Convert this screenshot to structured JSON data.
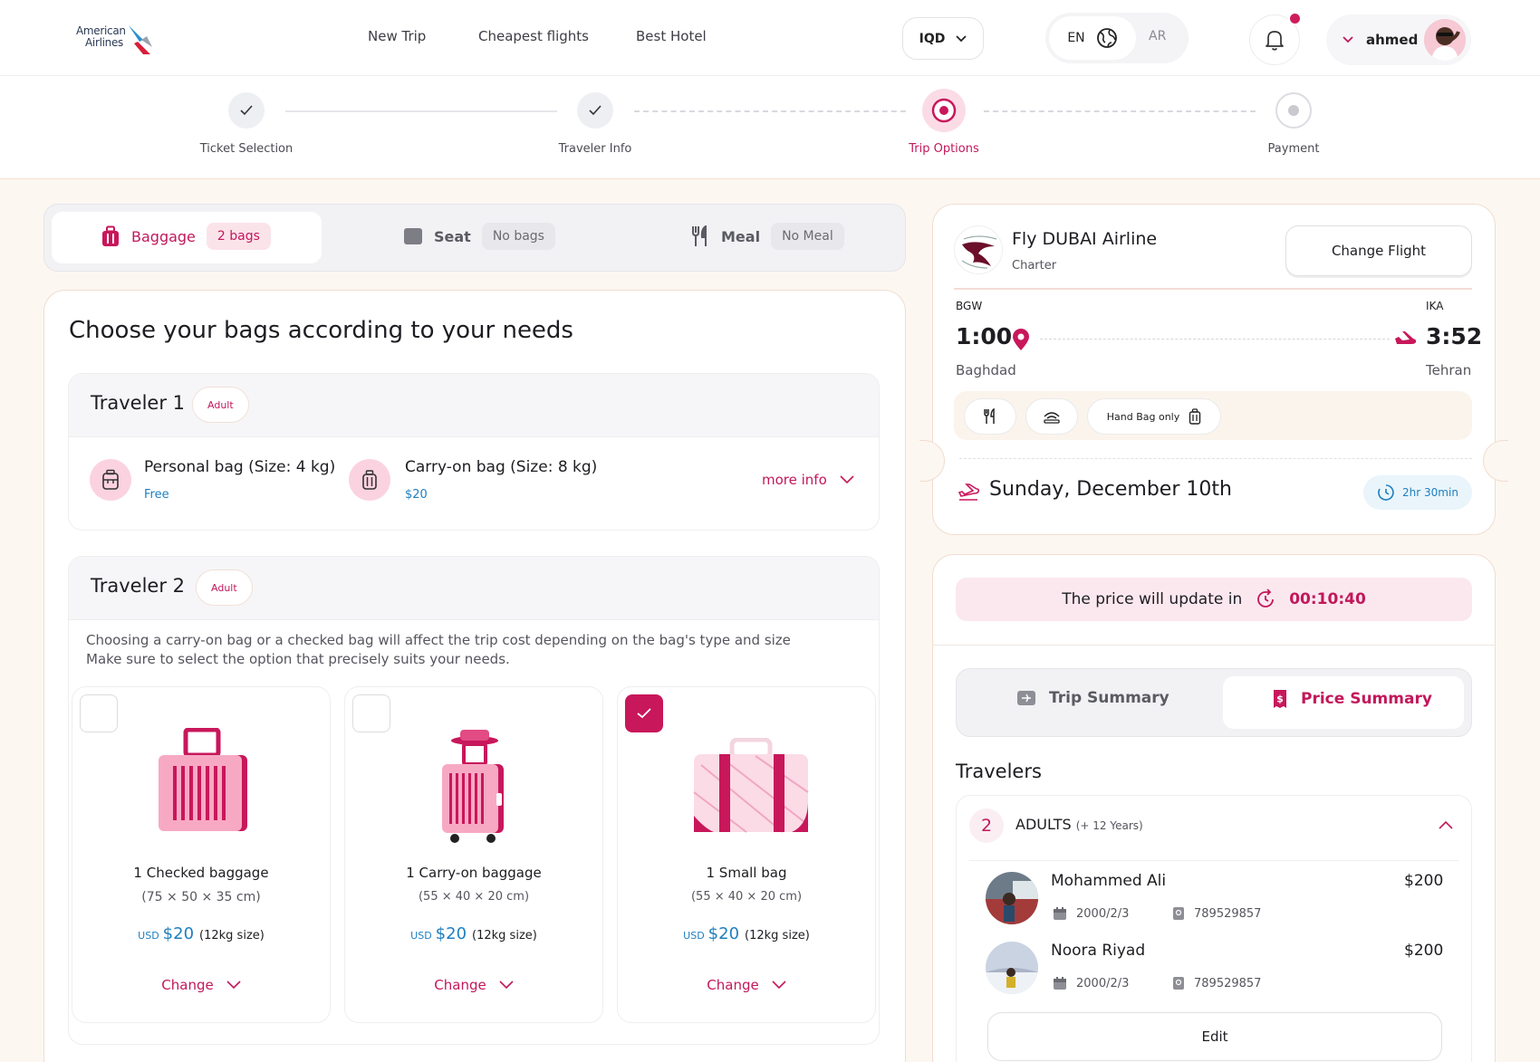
{
  "header": {
    "logo_line1": "American",
    "logo_line2": "Airlines",
    "nav": [
      "New Trip",
      "Cheapest flights",
      "Best Hotel"
    ],
    "currency": "IQD",
    "lang_en": "EN",
    "lang_ar": "AR",
    "user_name": "ahmed"
  },
  "stepper": {
    "steps": [
      {
        "label": "Ticket Selection",
        "state": "done"
      },
      {
        "label": "Traveler Info",
        "state": "done"
      },
      {
        "label": "Trip Options",
        "state": "active"
      },
      {
        "label": "Payment",
        "state": "pending"
      }
    ]
  },
  "tabs": {
    "baggage_label": "Baggage",
    "baggage_value": "2 bags",
    "seat_label": "Seat",
    "seat_value": "No bags",
    "meal_label": "Meal",
    "meal_value": "No Meal"
  },
  "main": {
    "title": "Choose your bags according to your needs",
    "traveler1": {
      "title": "Traveler 1",
      "badge": "Adult",
      "personal_bag": "Personal bag (Size: 4 kg)",
      "personal_price": "Free",
      "carry_bag": "Carry-on bag (Size: 8 kg)",
      "carry_price": "$20",
      "more_info": "more info"
    },
    "traveler2": {
      "title": "Traveler 2",
      "badge": "Adult",
      "note_line1": "Choosing a carry-on bag or a checked bag will affect the trip cost depending on the bag's type and size",
      "note_line2": "Make sure to select the option that precisely suits your needs.",
      "options": [
        {
          "title": "1 Checked baggage",
          "size": "(75 × 50 × 35 cm)",
          "currency": "USD",
          "price": "$20",
          "weight": "(12kg size)",
          "change": "Change",
          "checked": false
        },
        {
          "title": "1 Carry-on baggage",
          "size": "(55 × 40 × 20 cm)",
          "currency": "USD",
          "price": "$20",
          "weight": "(12kg size)",
          "change": "Change",
          "checked": false
        },
        {
          "title": "1 Small bag",
          "size": "(55 × 40 × 20 cm)",
          "currency": "USD",
          "price": "$20",
          "weight": "(12kg size)",
          "change": "Change",
          "checked": true
        }
      ]
    }
  },
  "flight": {
    "airline": "Fly DUBAI Airline",
    "type": "Charter",
    "change_button": "Change Flight",
    "from_code": "BGW",
    "from_time": "1:00",
    "from_city": "Baghdad",
    "to_code": "IKA",
    "to_time": "3:52",
    "to_city": "Tehran",
    "amenity_bag": "Hand Bag only",
    "date": "Sunday, December 10th",
    "duration": "2hr 30min"
  },
  "price": {
    "timer_text": "The price will update in",
    "timer_value": "00:10:40",
    "tab_trip": "Trip Summary",
    "tab_price": "Price Summary",
    "travelers_title": "Travelers",
    "adult_count": "2",
    "adults_label": "ADULTS",
    "adults_sub": "(+ 12 Years)",
    "passengers": [
      {
        "name": "Mohammed Ali",
        "price": "$200",
        "dob": "2000/2/3",
        "passport": "789529857"
      },
      {
        "name": "Noora Riyad",
        "price": "$200",
        "dob": "2000/2/3",
        "passport": "789529857"
      }
    ],
    "edit": "Edit"
  },
  "colors": {
    "accent": "#c2185b",
    "accent_light": "#fbd3e0",
    "price_blue": "#1e7fc0",
    "page_bg": "#fdf7f1"
  }
}
